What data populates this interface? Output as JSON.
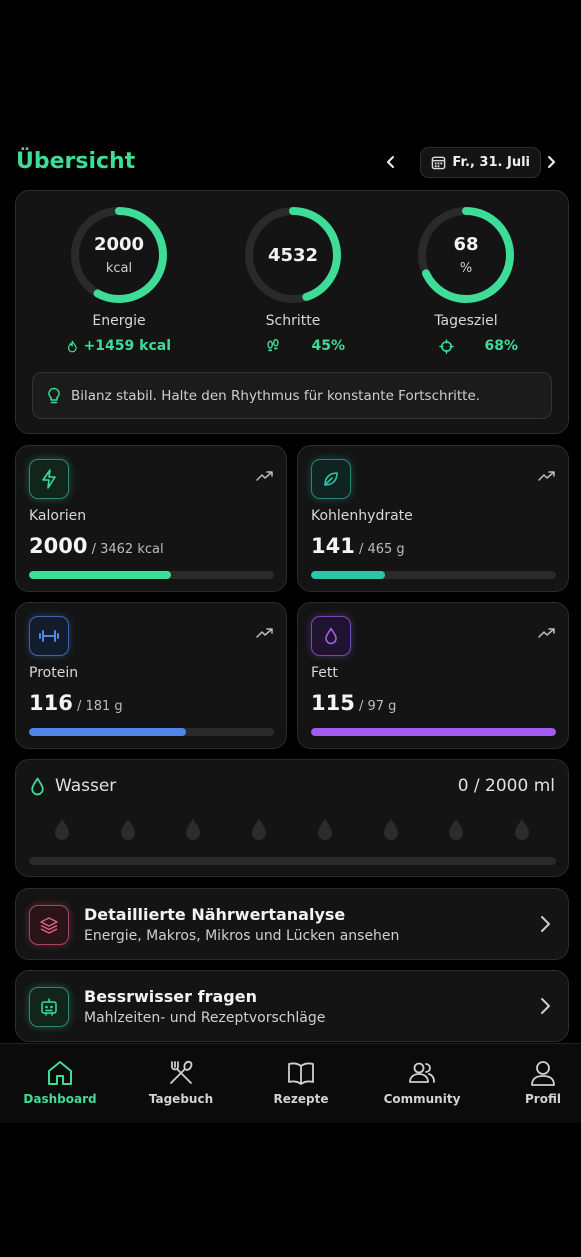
{
  "header": {
    "title": "Übersicht",
    "date": "Fr., 31. Juli"
  },
  "summary": {
    "rings": [
      {
        "value": "2000",
        "unit": "kcal",
        "label": "Energie",
        "sub": "+1459 kcal",
        "progress": 0.58,
        "sub_icon": "flame-icon"
      },
      {
        "value": "4532",
        "unit": "",
        "label": "Schritte",
        "sub": "45%",
        "progress": 0.45,
        "sub_icon": "footsteps-icon"
      },
      {
        "value": "68",
        "unit": "%",
        "label": "Tagesziel",
        "sub": "68%",
        "progress": 0.68,
        "sub_icon": "target-icon"
      }
    ],
    "hint": "Bilanz stabil. Halte den Rhythmus für konstante Fortschritte."
  },
  "macros": [
    {
      "name": "Kalorien",
      "value": "2000",
      "target": " / 3462 kcal",
      "progress": 0.578,
      "color": "#3ddc97",
      "icon": "lightning-icon"
    },
    {
      "name": "Kohlenhydrate",
      "value": "141",
      "target": " / 465 g",
      "progress": 0.303,
      "color": "#2ec4a6",
      "icon": "leaf-icon"
    },
    {
      "name": "Protein",
      "value": "116",
      "target": " / 181 g",
      "progress": 0.641,
      "color": "#4f86e8",
      "icon": "dumbbell-icon"
    },
    {
      "name": "Fett",
      "value": "115",
      "target": " / 97 g",
      "progress": 1.0,
      "color": "#a35cf0",
      "icon": "droplet-icon"
    }
  ],
  "water": {
    "label": "Wasser",
    "amount": "0 / 2000 ml",
    "glasses_filled": 0,
    "glasses_total": 8,
    "progress": 0
  },
  "actions": [
    {
      "title": "Detaillierte Nährwertanalyse",
      "subtitle": "Energie, Makros, Mikros und Lücken ansehen",
      "icon": "layers-icon",
      "color": "#e0607a"
    },
    {
      "title": "Bessrwisser fragen",
      "subtitle": "Mahlzeiten- und Rezeptvorschläge",
      "icon": "robot-icon",
      "color": "#3ddc97"
    }
  ],
  "tabs": [
    {
      "label": "Dashboard",
      "icon": "home-icon",
      "active": true
    },
    {
      "label": "Tagebuch",
      "icon": "utensils-icon",
      "active": false
    },
    {
      "label": "Rezepte",
      "icon": "book-icon",
      "active": false
    },
    {
      "label": "Community",
      "icon": "users-icon",
      "active": false
    },
    {
      "label": "Profil",
      "icon": "user-icon",
      "active": false
    }
  ],
  "colors": {
    "accent": "#3ddc97",
    "background": "#000000",
    "card": "#141414"
  }
}
